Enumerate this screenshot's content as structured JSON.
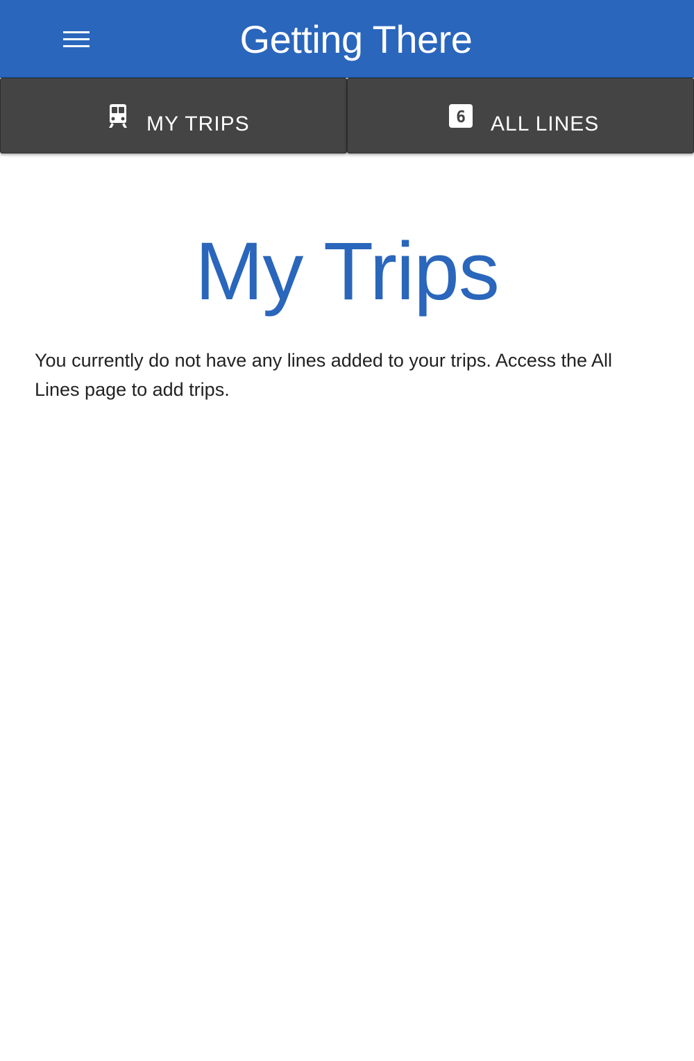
{
  "app_bar": {
    "title": "Getting There",
    "menu_icon": "hamburger-menu-icon"
  },
  "tabs": [
    {
      "label": "MY TRIPS",
      "icon": "train-icon"
    },
    {
      "label": "ALL LINES",
      "icon": "line-6-badge-icon",
      "badge_text": "6"
    }
  ],
  "main": {
    "heading": "My Trips",
    "empty_message": "You currently do not have any lines added to your trips. Access the All Lines page to add trips."
  },
  "colors": {
    "primary": "#2a66bb",
    "tab_background": "#444444",
    "text": "#222222"
  }
}
